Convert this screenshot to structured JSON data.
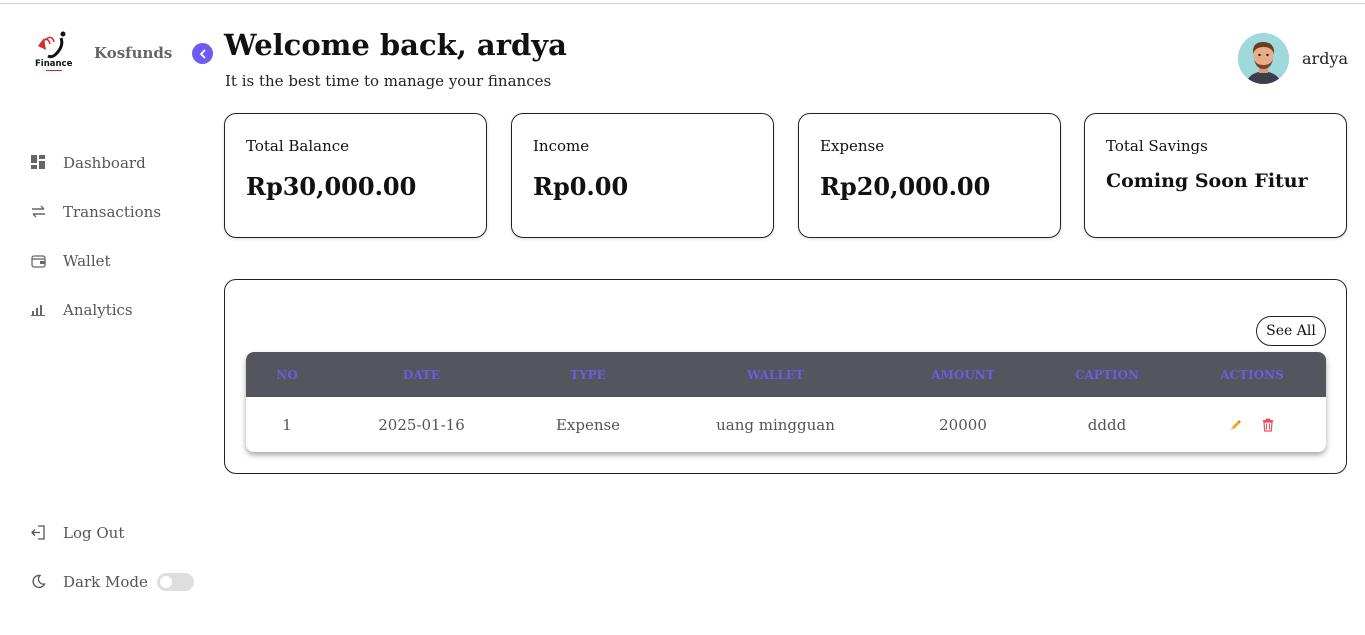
{
  "brand": {
    "name": "Kosfunds",
    "logo_text": "Finance"
  },
  "nav": {
    "items": [
      {
        "label": "Dashboard",
        "icon": "dashboard-icon"
      },
      {
        "label": "Transactions",
        "icon": "transactions-icon"
      },
      {
        "label": "Wallet",
        "icon": "wallet-icon"
      },
      {
        "label": "Analytics",
        "icon": "analytics-icon"
      }
    ],
    "logout_label": "Log Out",
    "darkmode_label": "Dark Mode",
    "darkmode_on": false
  },
  "header": {
    "welcome": "Welcome back, ardya",
    "subtitle": "It is the best time to manage your finances",
    "username": "ardya"
  },
  "cards": [
    {
      "title": "Total Balance",
      "value": "Rp30,000.00"
    },
    {
      "title": "Income",
      "value": "Rp0.00"
    },
    {
      "title": "Expense",
      "value": "Rp20,000.00"
    },
    {
      "title": "Total Savings",
      "value": "Coming Soon Fitur"
    }
  ],
  "table": {
    "see_all_label": "See All",
    "headers": [
      "NO",
      "DATE",
      "TYPE",
      "WALLET",
      "AMOUNT",
      "CAPTION",
      "ACTIONS"
    ],
    "rows": [
      {
        "no": "1",
        "date": "2025-01-16",
        "type": "Expense",
        "wallet": "uang mingguan",
        "amount": "20000",
        "caption": "dddd"
      }
    ]
  },
  "colors": {
    "accent": "#6e5cf2",
    "table_header_bg": "#55555d",
    "table_header_text": "#6a5de0",
    "edit_icon": "#f0a81c",
    "delete_icon": "#e8505b"
  }
}
